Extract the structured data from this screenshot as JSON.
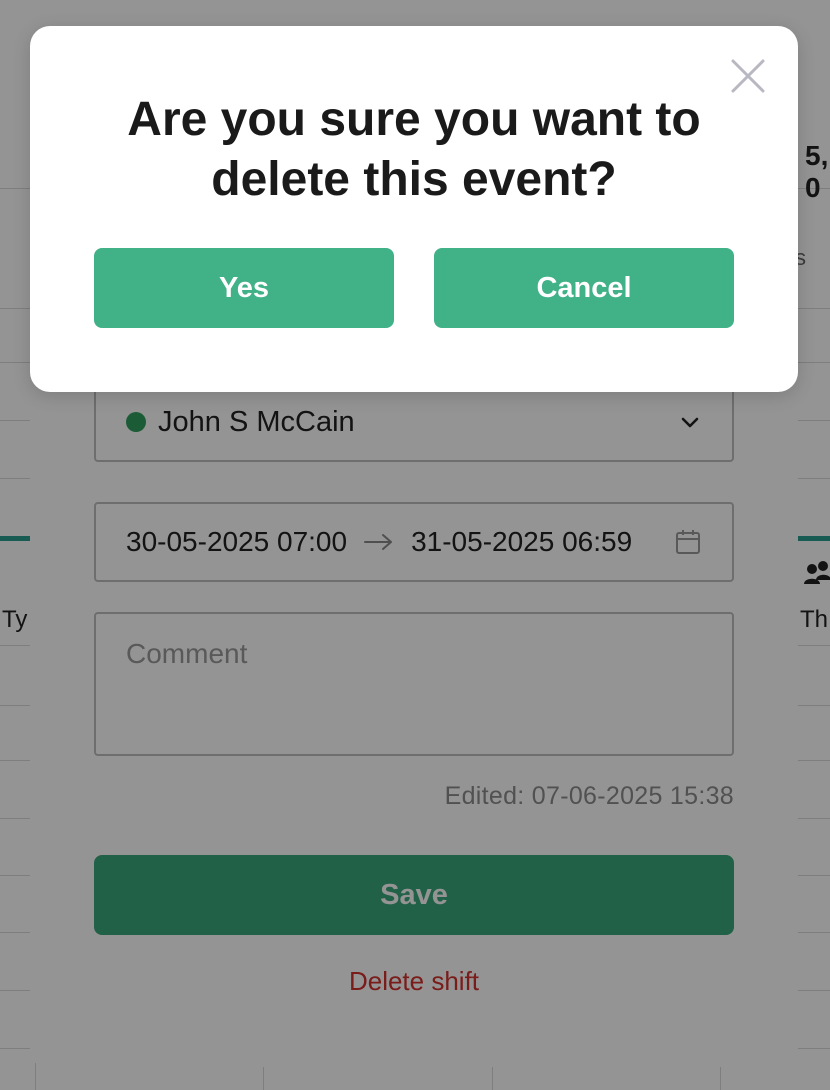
{
  "background": {
    "partial_header_text": "5, 0",
    "partial_letter_right": "s",
    "column_left_label": "Ty",
    "column_right_label": "Th",
    "people_icon": "people-icon"
  },
  "edit_modal": {
    "assignee": {
      "name": "John S McCain",
      "status_color": "#2f9d5c",
      "icon": "chevron-down-icon"
    },
    "date_range": {
      "start": "30-05-2025 07:00",
      "end": "31-05-2025 06:59",
      "arrow_icon": "arrow-right-icon",
      "calendar_icon": "calendar-icon"
    },
    "comment_placeholder": "Comment",
    "edited_text": "Edited: 07-06-2025 15:38",
    "save_label": "Save",
    "delete_label": "Delete shift",
    "save_color": "#3aa87a",
    "delete_color": "#d0312d"
  },
  "confirm_dialog": {
    "title": "Are you sure you want to delete this event?",
    "yes_label": "Yes",
    "cancel_label": "Cancel",
    "close_icon": "close-icon",
    "button_color": "#41b188"
  }
}
